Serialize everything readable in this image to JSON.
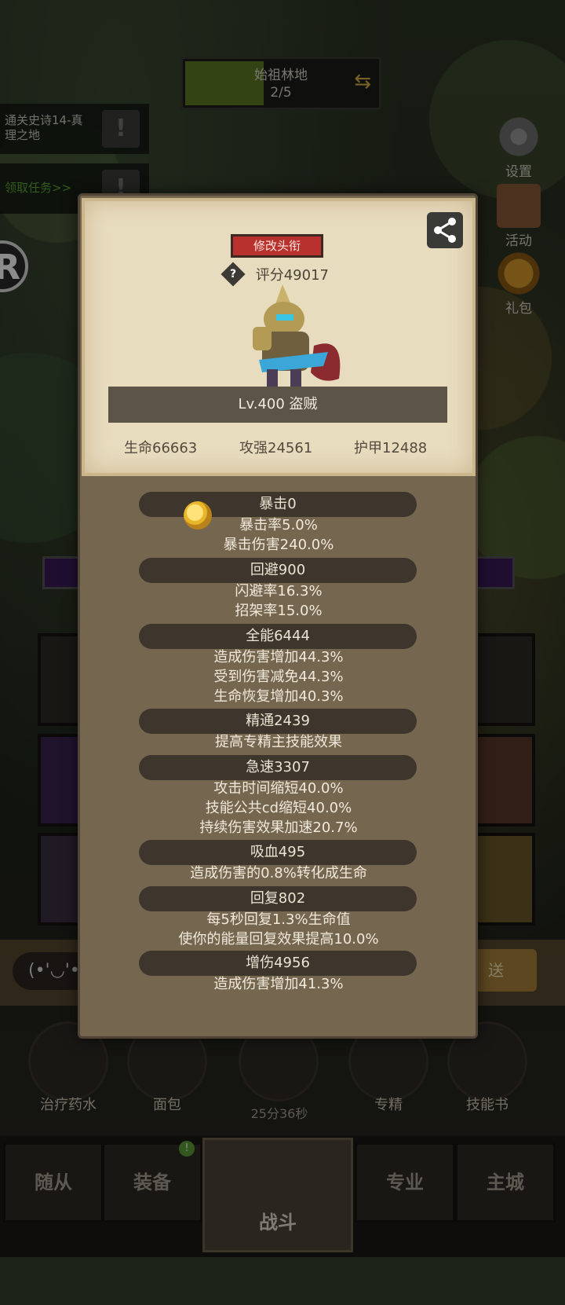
{
  "background": {
    "zone": {
      "name": "始祖林地",
      "progress": "2/5",
      "progress_fraction": 0.4
    },
    "quests": [
      {
        "text": "通关史诗14-真理之地",
        "button_icon": "exclamation-icon"
      },
      {
        "text": "领取任务>>",
        "button_icon": "exclamation-icon"
      }
    ],
    "side_menu": [
      {
        "label": "设置",
        "icon": "gear-icon"
      },
      {
        "label": "活动",
        "icon": "calendar-icon"
      },
      {
        "label": "礼包",
        "icon": "gift-icon"
      }
    ],
    "r_badge": "R",
    "emoji_button": "(•'◡'•",
    "send_button": "送",
    "items": [
      {
        "label": "治疗药水",
        "icon": "potion-icon"
      },
      {
        "label": "面包",
        "icon": "bread-icon"
      },
      {
        "label": "",
        "icon": "chest-icon"
      },
      {
        "label": "专精",
        "icon": "spec-icon"
      },
      {
        "label": "技能书",
        "icon": "skill-book-icon"
      }
    ],
    "timer": "25分36秒",
    "nav": [
      "随从",
      "装备",
      "战斗",
      "专业",
      "主城"
    ],
    "nav_badge": "!"
  },
  "popup": {
    "title_button": "修改头衔",
    "score": "评分49017",
    "help_icon": "?",
    "level_class": "Lv.400 盗贼",
    "stats": {
      "hp": "生命66663",
      "attack": "攻强24561",
      "armor": "护甲12488"
    },
    "sections": [
      {
        "header": "暴击0",
        "details": [
          "暴击率5.0%",
          "暴击伤害240.0%"
        ]
      },
      {
        "header": "回避900",
        "details": [
          "闪避率16.3%",
          "招架率15.0%"
        ]
      },
      {
        "header": "全能6444",
        "details": [
          "造成伤害增加44.3%",
          "受到伤害减免44.3%",
          "生命恢复增加40.3%"
        ]
      },
      {
        "header": "精通2439",
        "details": [
          "提高专精主技能效果"
        ]
      },
      {
        "header": "急速3307",
        "details": [
          "攻击时间缩短40.0%",
          "技能公共cd缩短40.0%",
          "持续伤害效果加速20.7%"
        ]
      },
      {
        "header": "吸血495",
        "details": [
          "造成伤害的0.8%转化成生命"
        ]
      },
      {
        "header": "回复802",
        "details": [
          "每5秒回复1.3%生命值",
          "使你的能量回复效果提高10.0%"
        ]
      },
      {
        "header": "增伤4956",
        "details": [
          "造成伤害增加41.3%"
        ]
      }
    ]
  },
  "colors": {
    "accent_red": "#b8312f",
    "parchment": "#e8dcbf",
    "panel": "#756650"
  }
}
